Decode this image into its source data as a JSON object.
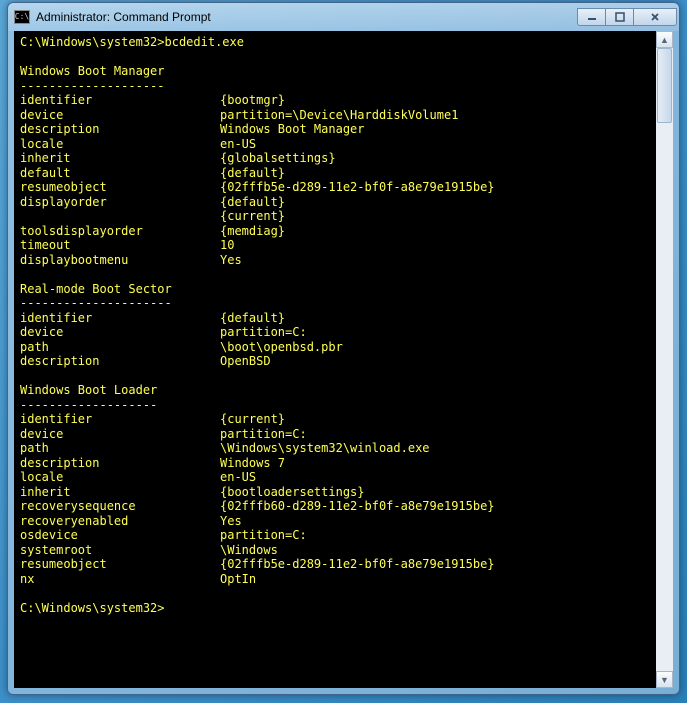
{
  "window": {
    "title": "Administrator: Command Prompt",
    "icon_label": "C:\\"
  },
  "prompt1": {
    "path": "C:\\Windows\\system32>",
    "command": "bcdedit.exe"
  },
  "sections": [
    {
      "title": "Windows Boot Manager",
      "underline": "--------------------",
      "rows": [
        {
          "k": "identifier",
          "v": "{bootmgr}"
        },
        {
          "k": "device",
          "v": "partition=\\Device\\HarddiskVolume1"
        },
        {
          "k": "description",
          "v": "Windows Boot Manager"
        },
        {
          "k": "locale",
          "v": "en-US"
        },
        {
          "k": "inherit",
          "v": "{globalsettings}"
        },
        {
          "k": "default",
          "v": "{default}"
        },
        {
          "k": "resumeobject",
          "v": "{02fffb5e-d289-11e2-bf0f-a8e79e1915be}"
        },
        {
          "k": "displayorder",
          "v": "{default}"
        },
        {
          "k": "",
          "v": "{current}"
        },
        {
          "k": "toolsdisplayorder",
          "v": "{memdiag}"
        },
        {
          "k": "timeout",
          "v": "10"
        },
        {
          "k": "displaybootmenu",
          "v": "Yes"
        }
      ]
    },
    {
      "title": "Real-mode Boot Sector",
      "underline": "---------------------",
      "rows": [
        {
          "k": "identifier",
          "v": "{default}"
        },
        {
          "k": "device",
          "v": "partition=C:"
        },
        {
          "k": "path",
          "v": "\\boot\\openbsd.pbr"
        },
        {
          "k": "description",
          "v": "OpenBSD"
        }
      ]
    },
    {
      "title": "Windows Boot Loader",
      "underline": "-------------------",
      "rows": [
        {
          "k": "identifier",
          "v": "{current}"
        },
        {
          "k": "device",
          "v": "partition=C:"
        },
        {
          "k": "path",
          "v": "\\Windows\\system32\\winload.exe"
        },
        {
          "k": "description",
          "v": "Windows 7"
        },
        {
          "k": "locale",
          "v": "en-US"
        },
        {
          "k": "inherit",
          "v": "{bootloadersettings}"
        },
        {
          "k": "recoverysequence",
          "v": "{02fffb60-d289-11e2-bf0f-a8e79e1915be}"
        },
        {
          "k": "recoveryenabled",
          "v": "Yes"
        },
        {
          "k": "osdevice",
          "v": "partition=C:"
        },
        {
          "k": "systemroot",
          "v": "\\Windows"
        },
        {
          "k": "resumeobject",
          "v": "{02fffb5e-d289-11e2-bf0f-a8e79e1915be}"
        },
        {
          "k": "nx",
          "v": "OptIn"
        }
      ]
    }
  ],
  "prompt2": {
    "path": "C:\\Windows\\system32>",
    "command": ""
  }
}
